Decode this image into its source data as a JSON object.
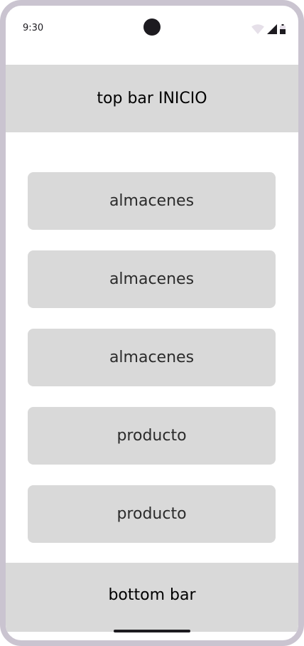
{
  "status_bar": {
    "time": "9:30",
    "icons": [
      "wifi-icon",
      "signal-icon",
      "battery-icon"
    ]
  },
  "top_bar": {
    "title": "top bar INICIO"
  },
  "menu": {
    "buttons": [
      {
        "label": "almacenes"
      },
      {
        "label": "almacenes"
      },
      {
        "label": "almacenes"
      },
      {
        "label": "producto"
      },
      {
        "label": "producto"
      }
    ]
  },
  "bottom_bar": {
    "title": "bottom bar"
  },
  "colors": {
    "frame": "#cac4d0",
    "bar_background": "#d9d9d9",
    "button_background": "#d9d9d9",
    "text": "#1d1b20"
  }
}
